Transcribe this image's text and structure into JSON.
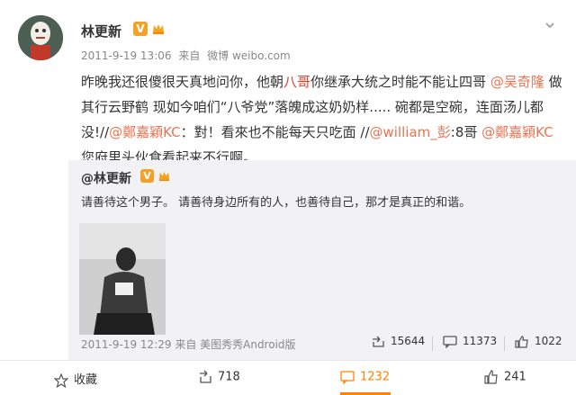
{
  "post": {
    "username": "林更新",
    "verified_badge": "V",
    "meta_time": "2011-9-19 13:06",
    "meta_from": "来自",
    "meta_source": "微博 weibo.com",
    "text_parts": {
      "p1": "昨晚我还很傻很天真地问你，他朝",
      "kw1": "八哥",
      "p2": "你继承大统之时能不能让四哥 ",
      "m1": "@吴奇隆",
      "p3": " 做其行云野鹤   现如今咱们“八爷党”落魄成这奶奶样.....  碗都是空碗，连面汤儿都没!//",
      "m2": "@鄭嘉穎KC",
      "p4": "：對！看來也不能每天只吃面 //",
      "m3": "@william_彭",
      "p5": ":8哥 ",
      "m4": "@鄭嘉穎KC",
      "p6": "  您府里头伙食看起来不行啊。"
    }
  },
  "repost": {
    "author": "@林更新",
    "verified_badge": "V",
    "text": "请善待这个男子。 请善待身边所有的人，也善待自己，那才是真正的和谐。",
    "meta": "2011-9-19 12:29 来自 美图秀秀Android版",
    "forwards": "15644",
    "comments": "11373",
    "likes": "1022"
  },
  "actions": {
    "favorite": "收藏",
    "forward": "718",
    "comment": "1232",
    "like": "241"
  },
  "colors": {
    "accent": "#ff8200",
    "mention": "#eb7350",
    "keyword": "#e8412c",
    "badge": "#f3a128"
  }
}
